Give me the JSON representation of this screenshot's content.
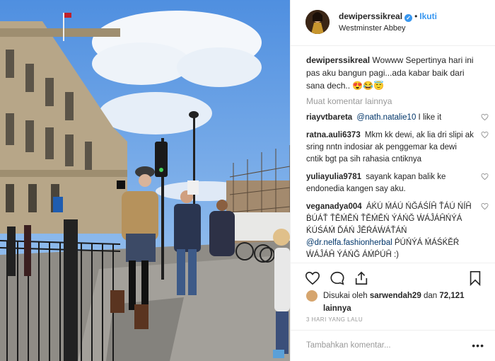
{
  "header": {
    "username": "dewiperssikreal",
    "follow_label": "Ikuti",
    "location": "Westminster Abbey",
    "separator": "•"
  },
  "caption": {
    "username": "dewiperssikreal",
    "text": "Wowww Sepertinya hari ini pas aku bangun pagi...ada kabar baik dari sana dech..",
    "emojis": "😍😂😇"
  },
  "load_more_label": "Muat komentar lainnya",
  "comments": [
    {
      "username": "riayvtbareta",
      "mention": "@nath.natalie10",
      "text": " I like it"
    },
    {
      "username": "ratna.auli6373",
      "mention": "",
      "text": "Mkm kk dewi, ak lia dri slipi ak sring nntn indosiar ak penggemar ka dewi cntik bgt pa sih rahasia cntiknya"
    },
    {
      "username": "yuliayulia9781",
      "mention": "",
      "text": "sayank kapan balik ke endonedia kangen say aku."
    },
    {
      "username": "veganadya004",
      "text_before": "ÁḰÚ ḾÁÚ ŃĞÁŚÍĤ ŤÁÚ ŃÍĤ ḂÚÁŤ ŤĚḾĚŃ ŤĚḾĚŃ ÝÁŃĞ ẂÁĴÁĤŃÝÁ ḰÚŚÁḾ ĎÁŃ ĴĚŔÁẂÁŤÁŃ ",
      "mention": "@dr.nelfa.fashionherbal",
      "text": " ṔÚŃÝÁ ḾÁŚḰĚŔ ẂÁĴÁĤ ÝÁŃĞ ÁḾṔÚĤ :)"
    }
  ],
  "likes": {
    "prefix": "Disukai oleh",
    "liker": "sarwendah29",
    "joiner": "dan",
    "count": "72,121",
    "suffix": "lainnya"
  },
  "time_ago": "3 HARI YANG LALU",
  "add_comment_placeholder": "Tambahkan komentar...",
  "more_label": "•••",
  "icons": {
    "like": "heart-icon",
    "comment": "comment-icon",
    "share": "share-icon",
    "save": "bookmark-icon"
  },
  "colors": {
    "link": "#3897f0",
    "mention": "#003569",
    "muted": "#999999",
    "text": "#262626"
  }
}
